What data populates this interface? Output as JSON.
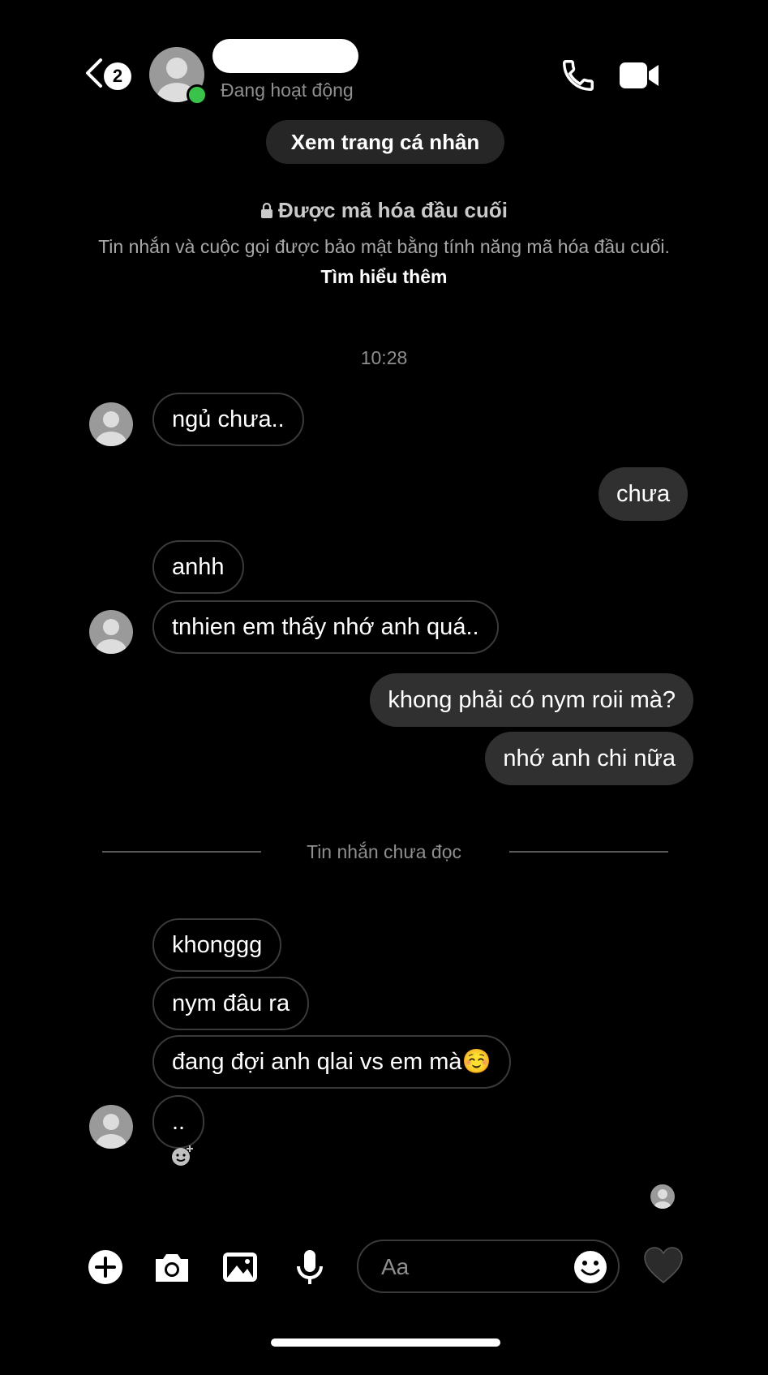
{
  "header": {
    "back_badge": "2",
    "active_status": "Đang hoạt động",
    "profile_button": "Xem trang cá nhân"
  },
  "encryption": {
    "title": "Được mã hóa đầu cuối",
    "text": "Tin nhắn và cuộc gọi được bảo mật bằng tính năng mã hóa đầu cuối.",
    "link": "Tìm hiểu thêm"
  },
  "timestamp": "10:28",
  "messages": [
    {
      "side": "in",
      "text": "ngủ chưa.."
    },
    {
      "side": "out",
      "text": "chưa"
    },
    {
      "side": "in",
      "text": "anhh"
    },
    {
      "side": "in",
      "text": "tnhien em thấy nhớ anh quá.."
    },
    {
      "side": "out",
      "text": "khong phải có nym roii mà?"
    },
    {
      "side": "out",
      "text": "nhớ anh chi nữa"
    },
    {
      "side": "in",
      "text": "khonggg"
    },
    {
      "side": "in",
      "text": "nym đâu ra"
    },
    {
      "side": "in",
      "text": "đang đợi anh qlai vs em mà☺️"
    },
    {
      "side": "in",
      "text": ".."
    }
  ],
  "unread_divider": "Tin nhắn chưa đọc",
  "composer": {
    "placeholder": "Aa"
  },
  "icons": [
    "back-chevron-icon",
    "phone-icon",
    "video-camera-icon",
    "lock-icon",
    "plus-icon",
    "camera-icon",
    "image-icon",
    "microphone-icon",
    "smiley-icon",
    "heart-icon",
    "add-reaction-icon"
  ],
  "colors": {
    "online": "#3ac34b",
    "bubble_out": "#303030",
    "bubble_in_border": "#3a3a3a"
  }
}
